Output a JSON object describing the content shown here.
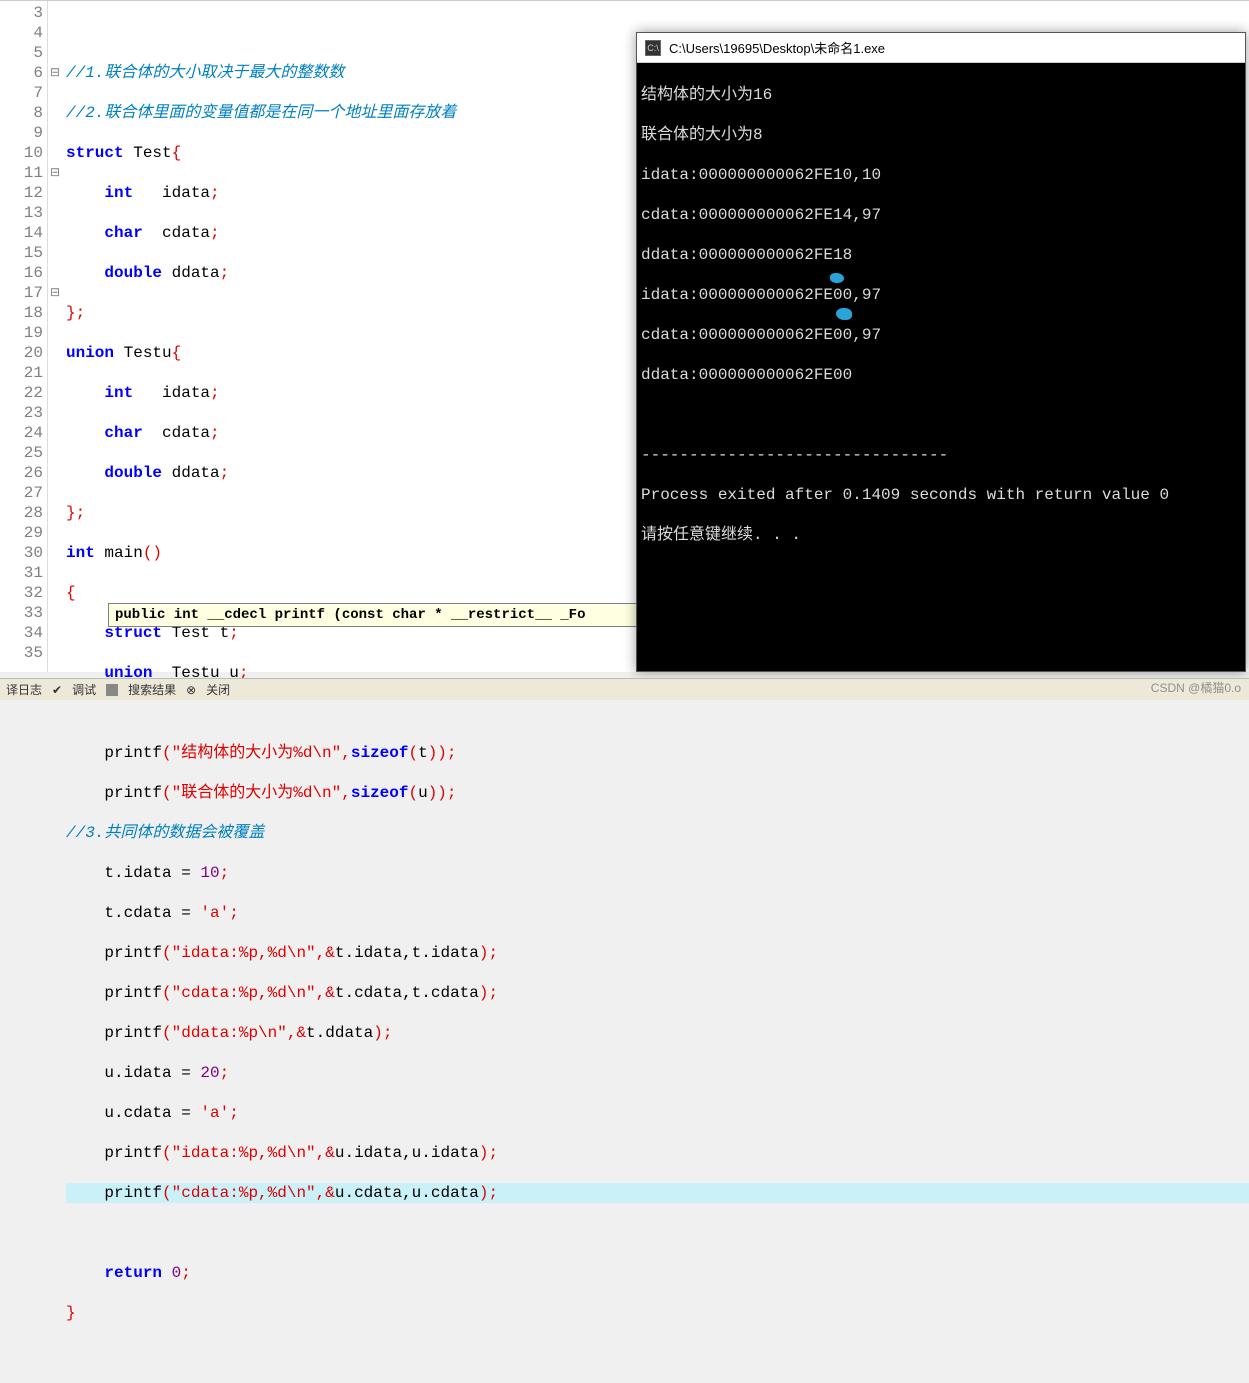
{
  "editor": {
    "lines": {
      "l3": "",
      "c4": "//1.联合体的大小取决于最大的整数数",
      "c5": "//2.联合体里面的变量值都是在同一个地址里面存放着",
      "kw_struct": "struct",
      "kw_union": "union",
      "kw_int": "int",
      "kw_char": "char",
      "kw_double": "double",
      "kw_return": "return",
      "kw_sizeof": "sizeof",
      "name_Test": " Test",
      "name_Testu": " Testu",
      "field_idata": "   idata",
      "field_cdata": "  cdata",
      "field_ddata": " ddata",
      "main": " main",
      "decl_t": " Test t",
      "decl_u": "  Testu u",
      "printf": "printf",
      "str21": "\"结构体的大小为%d\\n\"",
      "str22": "\"联合体的大小为%d\\n\"",
      "c23": "//3.共同体的数据会被覆盖",
      "assign_tidata": "t.idata = ",
      "v10": "10",
      "assign_tcdata": "t.cdata = ",
      "va": "'a'",
      "str_idata": "\"idata:%p,%d\\n\"",
      "str_cdata": "\"cdata:%p,%d\\n\"",
      "str_ddata": "\"ddata:%p\\n\"",
      "arg_tidata": "t.idata,t.idata",
      "arg_tcdata": "t.cdata,t.cdata",
      "arg_tddata": "t.ddata",
      "assign_uidata": "u.idata = ",
      "v20": "20",
      "assign_ucdata": "u.cdata = ",
      "arg_uidata": "u.idata,u.idata",
      "arg_ucdata": "u.cdata,u.cdata",
      "v0": "0"
    },
    "tooltip": "public int __cdecl printf (const char * __restrict__ _Fo",
    "line_numbers": [
      "3",
      "4",
      "5",
      "6",
      "7",
      "8",
      "9",
      "10",
      "11",
      "12",
      "13",
      "14",
      "15",
      "16",
      "17",
      "18",
      "19",
      "20",
      "21",
      "22",
      "23",
      "24",
      "25",
      "26",
      "27",
      "28",
      "29",
      "30",
      "31",
      "32",
      "33",
      "34",
      "35"
    ]
  },
  "console": {
    "title": "C:\\Users\\19695\\Desktop\\未命名1.exe",
    "out1": "结构体的大小为16",
    "out2": "联合体的大小为8",
    "out3": "idata:000000000062FE10,10",
    "out4": "cdata:000000000062FE14,97",
    "out5": "ddata:000000000062FE18",
    "out6": "idata:000000000062FE00,97",
    "out7": "cdata:000000000062FE00,97",
    "out8": "ddata:000000000062FE00",
    "sep": "--------------------------------",
    "exit": "Process exited after 0.1409 seconds with return value 0",
    "prompt": "请按任意键继续. . ."
  },
  "statusbar": {
    "logs": "译日志",
    "debug": "调试",
    "search": "搜索结果",
    "close": "关闭"
  },
  "watermark": "CSDN @橘猫0.o"
}
